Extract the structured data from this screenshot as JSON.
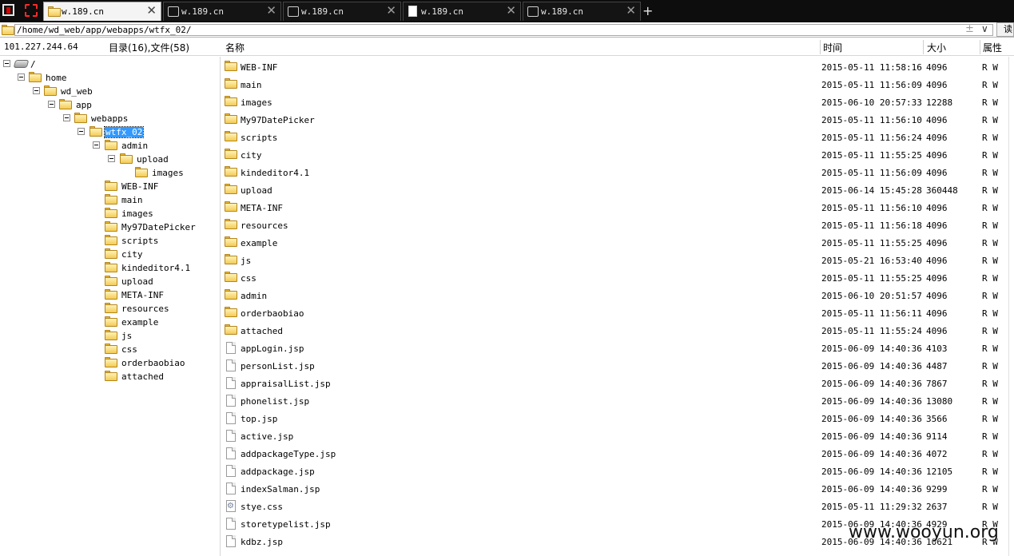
{
  "tabs": [
    {
      "label": "w.189.cn",
      "icon": "folder-icon",
      "active": true
    },
    {
      "label": "w.189.cn",
      "icon": "terminal-icon",
      "active": false
    },
    {
      "label": "w.189.cn",
      "icon": "terminal-icon",
      "active": false
    },
    {
      "label": "w.189.cn",
      "icon": "document-icon",
      "active": false
    },
    {
      "label": "w.189.cn",
      "icon": "terminal-icon",
      "active": false
    }
  ],
  "tab_close_glyph": "✕",
  "tab_add_glyph": "+",
  "address": {
    "path": "/home/wd_web/app/webapps/wtfx_02/",
    "plus_glyph": "±",
    "dropdown_glyph": "∨",
    "read_button": "读"
  },
  "header": {
    "ip": "101.227.244.64",
    "counts": "目录(16),文件(58)",
    "col_name": "名称",
    "col_time": "时间",
    "col_size": "大小",
    "col_attr": "属性"
  },
  "tree": {
    "root": "/",
    "path_nodes": [
      "home",
      "wd_web",
      "app",
      "webapps",
      "wtfx_02",
      "admin",
      "upload",
      "images"
    ],
    "children": [
      "WEB-INF",
      "main",
      "images",
      "My97DatePicker",
      "scripts",
      "city",
      "kindeditor4.1",
      "upload",
      "META-INF",
      "resources",
      "example",
      "js",
      "css",
      "orderbaobiao",
      "attached"
    ]
  },
  "files": [
    {
      "name": "WEB-INF",
      "time": "2015-05-11 11:58:16",
      "size": "4096",
      "attr": "R W",
      "type": "folder"
    },
    {
      "name": "main",
      "time": "2015-05-11 11:56:09",
      "size": "4096",
      "attr": "R W",
      "type": "folder"
    },
    {
      "name": "images",
      "time": "2015-06-10 20:57:33",
      "size": "12288",
      "attr": "R W",
      "type": "folder"
    },
    {
      "name": "My97DatePicker",
      "time": "2015-05-11 11:56:10",
      "size": "4096",
      "attr": "R W",
      "type": "folder"
    },
    {
      "name": "scripts",
      "time": "2015-05-11 11:56:24",
      "size": "4096",
      "attr": "R W",
      "type": "folder"
    },
    {
      "name": "city",
      "time": "2015-05-11 11:55:25",
      "size": "4096",
      "attr": "R W",
      "type": "folder"
    },
    {
      "name": "kindeditor4.1",
      "time": "2015-05-11 11:56:09",
      "size": "4096",
      "attr": "R W",
      "type": "folder"
    },
    {
      "name": "upload",
      "time": "2015-06-14 15:45:28",
      "size": "360448",
      "attr": "R W",
      "type": "folder"
    },
    {
      "name": "META-INF",
      "time": "2015-05-11 11:56:10",
      "size": "4096",
      "attr": "R W",
      "type": "folder"
    },
    {
      "name": "resources",
      "time": "2015-05-11 11:56:18",
      "size": "4096",
      "attr": "R W",
      "type": "folder"
    },
    {
      "name": "example",
      "time": "2015-05-11 11:55:25",
      "size": "4096",
      "attr": "R W",
      "type": "folder"
    },
    {
      "name": "js",
      "time": "2015-05-21 16:53:40",
      "size": "4096",
      "attr": "R W",
      "type": "folder"
    },
    {
      "name": "css",
      "time": "2015-05-11 11:55:25",
      "size": "4096",
      "attr": "R W",
      "type": "folder"
    },
    {
      "name": "admin",
      "time": "2015-06-10 20:51:57",
      "size": "4096",
      "attr": "R W",
      "type": "folder"
    },
    {
      "name": "orderbaobiao",
      "time": "2015-05-11 11:56:11",
      "size": "4096",
      "attr": "R W",
      "type": "folder"
    },
    {
      "name": "attached",
      "time": "2015-05-11 11:55:24",
      "size": "4096",
      "attr": "R W",
      "type": "folder"
    },
    {
      "name": "appLogin.jsp",
      "time": "2015-06-09 14:40:36",
      "size": "4103",
      "attr": "R W",
      "type": "file"
    },
    {
      "name": "personList.jsp",
      "time": "2015-06-09 14:40:36",
      "size": "4487",
      "attr": "R W",
      "type": "file"
    },
    {
      "name": "appraisalList.jsp",
      "time": "2015-06-09 14:40:36",
      "size": "7867",
      "attr": "R W",
      "type": "file"
    },
    {
      "name": "phonelist.jsp",
      "time": "2015-06-09 14:40:36",
      "size": "13080",
      "attr": "R W",
      "type": "file"
    },
    {
      "name": "top.jsp",
      "time": "2015-06-09 14:40:36",
      "size": "3566",
      "attr": "R W",
      "type": "file"
    },
    {
      "name": "active.jsp",
      "time": "2015-06-09 14:40:36",
      "size": "9114",
      "attr": "R W",
      "type": "file"
    },
    {
      "name": "addpackageType.jsp",
      "time": "2015-06-09 14:40:36",
      "size": "4072",
      "attr": "R W",
      "type": "file"
    },
    {
      "name": "addpackage.jsp",
      "time": "2015-06-09 14:40:36",
      "size": "12105",
      "attr": "R W",
      "type": "file"
    },
    {
      "name": "indexSalman.jsp",
      "time": "2015-06-09 14:40:36",
      "size": "9299",
      "attr": "R W",
      "type": "file"
    },
    {
      "name": "stye.css",
      "time": "2015-05-11 11:29:32",
      "size": "2637",
      "attr": "R W",
      "type": "css"
    },
    {
      "name": "storetypelist.jsp",
      "time": "2015-06-09 14:40:36",
      "size": "4929",
      "attr": "R W",
      "type": "file"
    },
    {
      "name": "kdbz.jsp",
      "time": "2015-06-09 14:40:36",
      "size": "10621",
      "attr": "R W",
      "type": "file"
    }
  ],
  "watermark": "www.wooyun.org",
  "colors": {
    "tabbar_bg": "#0d0d0d",
    "selection": "#3399ff",
    "folder": "#f4cc55"
  }
}
